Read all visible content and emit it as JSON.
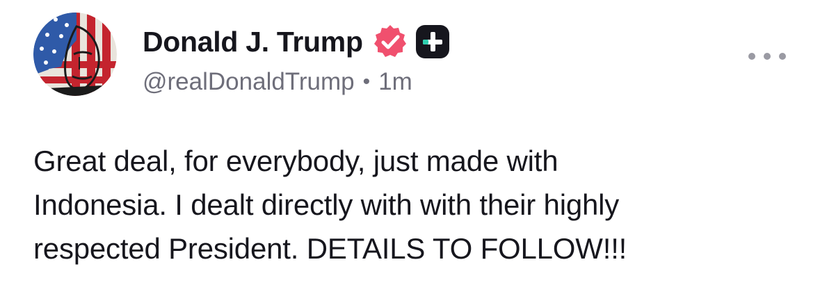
{
  "author": {
    "display_name": "Donald J. Trump",
    "handle": "@realDonaldTrump",
    "separator": "•",
    "timestamp": "1m",
    "avatar_icon": "flag-portrait-avatar",
    "verified_icon": "verified-badge-icon",
    "verified_color": "#f0506e",
    "plus_icon": "plus-badge-icon",
    "plus_badge_color": "#16161d",
    "plus_accent_color": "#2fd0b0"
  },
  "menu": {
    "icon": "more-horizontal-icon"
  },
  "post": {
    "lines": [
      "Great deal, for everybody, just made with",
      "Indonesia. I dealt directly with with their highly",
      "respected President. DETAILS TO FOLLOW!!!"
    ]
  },
  "colors": {
    "text_primary": "#16161d",
    "text_secondary": "#6e6e7a",
    "background": "#ffffff"
  }
}
